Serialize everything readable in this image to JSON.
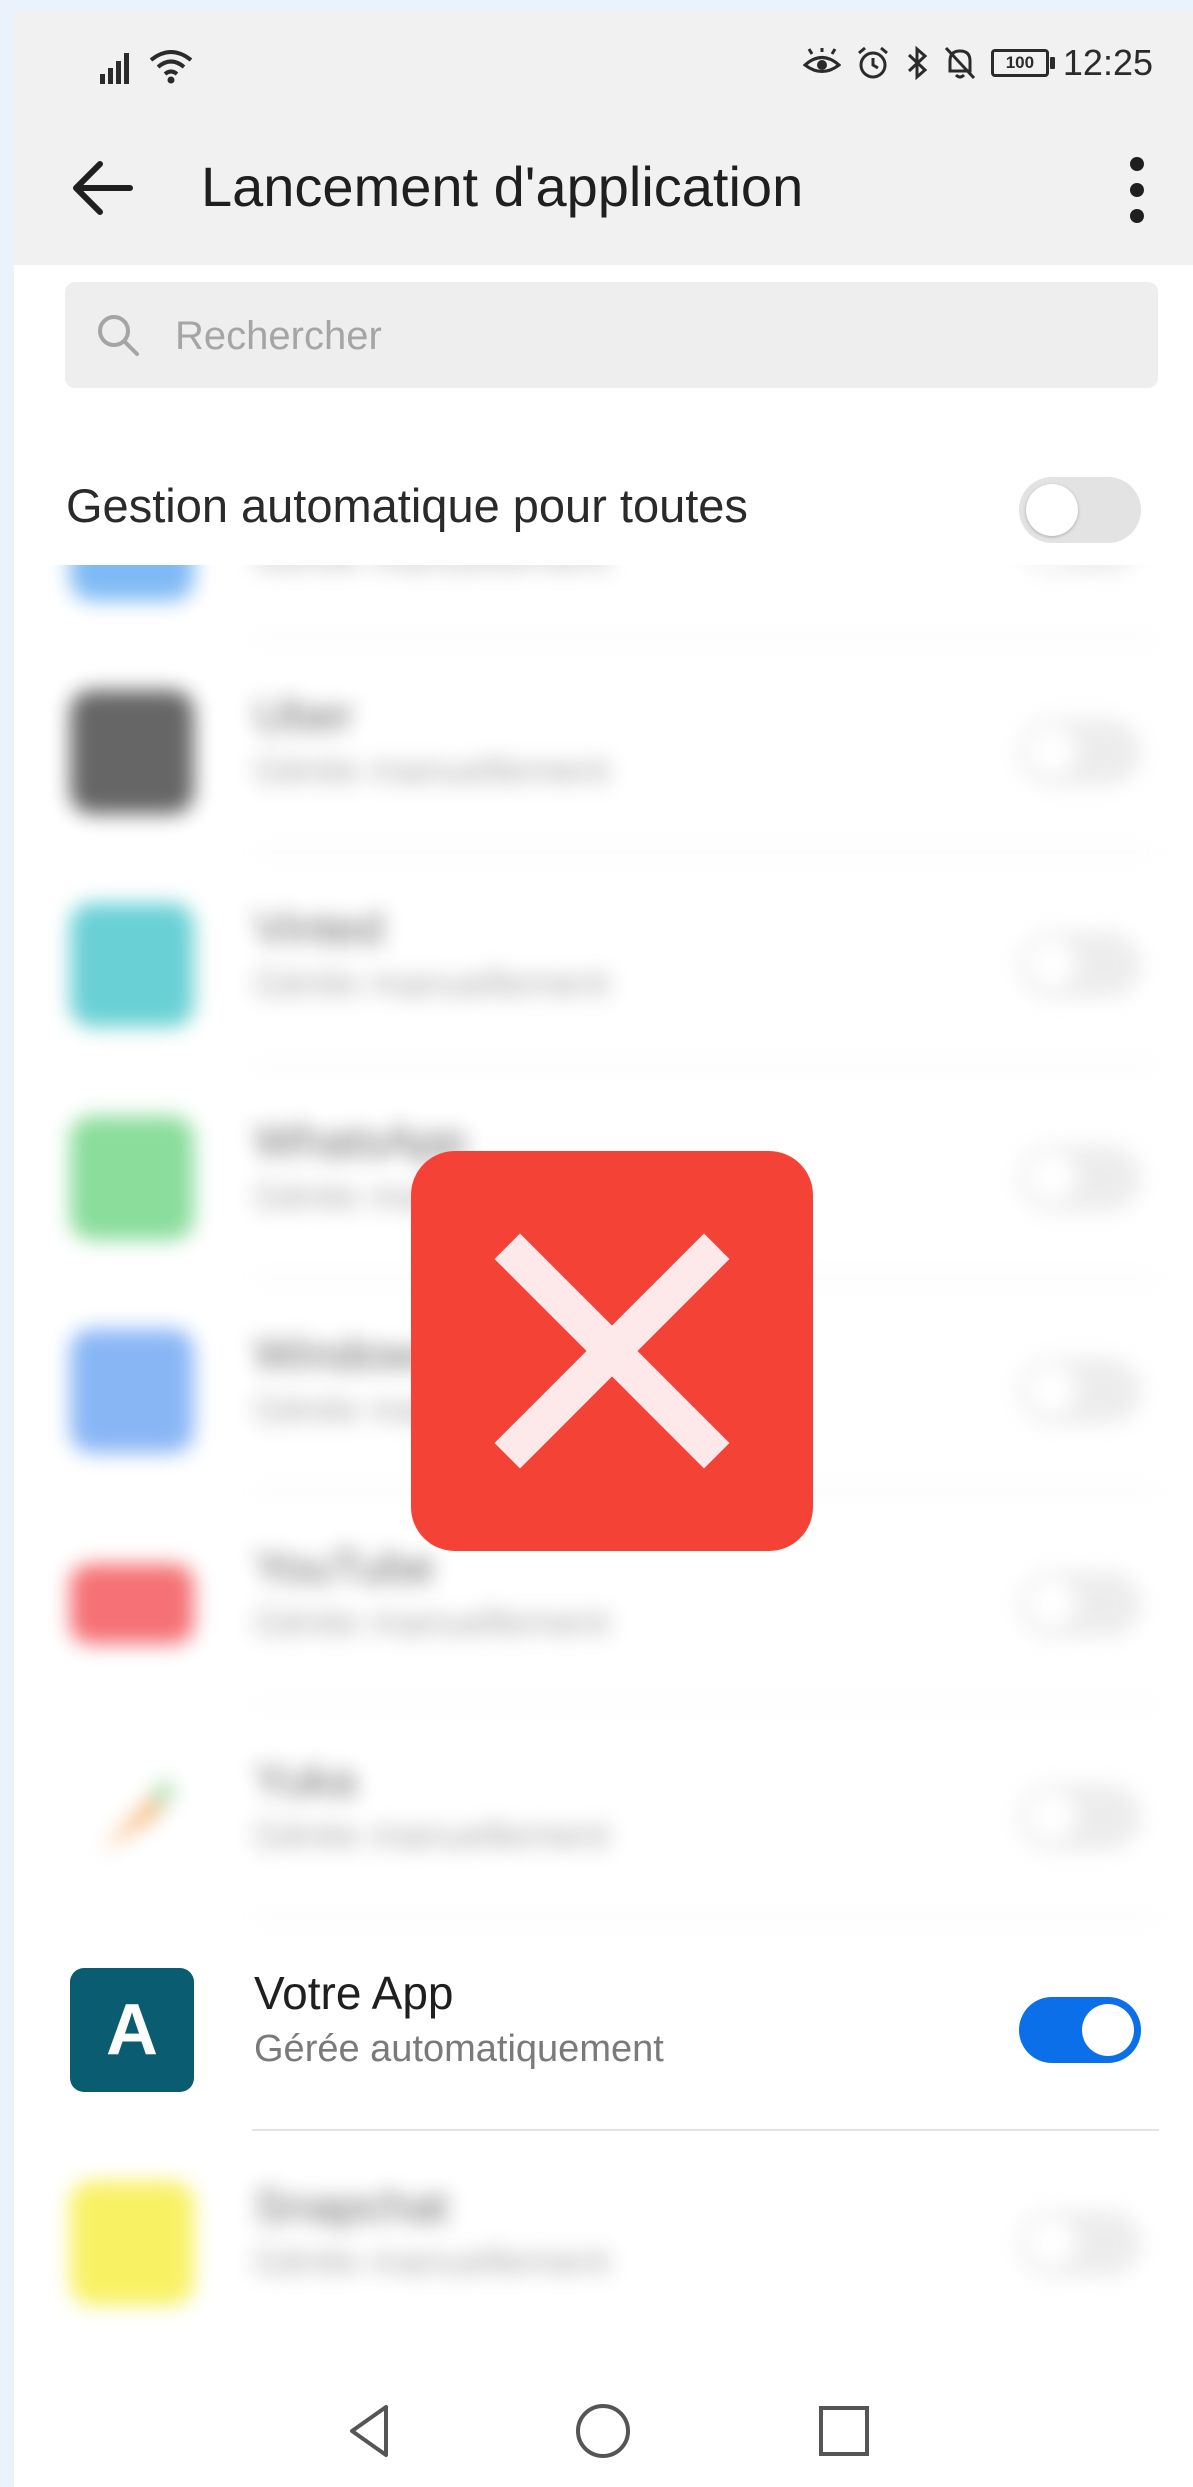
{
  "status_bar": {
    "time": "12:25",
    "battery": "100",
    "icons": [
      "signal-icon",
      "wifi-icon",
      "eye-icon",
      "alarm-icon",
      "bluetooth-icon",
      "mute-icon",
      "battery-icon"
    ]
  },
  "app_bar": {
    "title": "Lancement d'application",
    "back_icon": "back-arrow-icon",
    "menu_icon": "more-vertical-icon"
  },
  "search": {
    "placeholder": "Rechercher"
  },
  "global_toggle": {
    "label": "Gestion automatique pour toutes",
    "on": false
  },
  "apps": [
    {
      "name": "",
      "status": "Gérée manuellement",
      "icon_color": "#3c96f0",
      "on": false,
      "blurred": true
    },
    {
      "name": "Uber",
      "status": "Gérée manuellement",
      "icon_color": "#151515",
      "on": false,
      "blurred": true
    },
    {
      "name": "Vinted",
      "status": "Gérée manuellement",
      "icon_color": "#1ab8bf",
      "on": false,
      "blurred": true
    },
    {
      "name": "WhatsApp",
      "status": "Gérée manuellement",
      "icon_color": "#4ccb67",
      "on": false,
      "blurred": true
    },
    {
      "name": "Windows",
      "status": "Gérée manuellement",
      "icon_color": "#4a90f0",
      "on": false,
      "blurred": true
    },
    {
      "name": "YouTube",
      "status": "Gérée manuellement",
      "icon_color": "#f0262c",
      "on": false,
      "blurred": true
    },
    {
      "name": "Yuka",
      "status": "Gérée manuellement",
      "icon_color": "#f08a24",
      "on": false,
      "blurred": true
    },
    {
      "name": "Votre App",
      "status": "Gérée automatiquement",
      "icon_letter": "A",
      "icon_color": "#0a5c70",
      "on": true,
      "blurred": false
    },
    {
      "name": "Snapchat",
      "status": "Gérée manuellement",
      "icon_color": "#f5ea10",
      "on": false,
      "blurred": true
    }
  ],
  "overlay": {
    "icon": "x-mark-icon",
    "color": "#f44336"
  },
  "nav_bar": {
    "icons": [
      "nav-back-icon",
      "nav-home-icon",
      "nav-recents-icon"
    ]
  }
}
